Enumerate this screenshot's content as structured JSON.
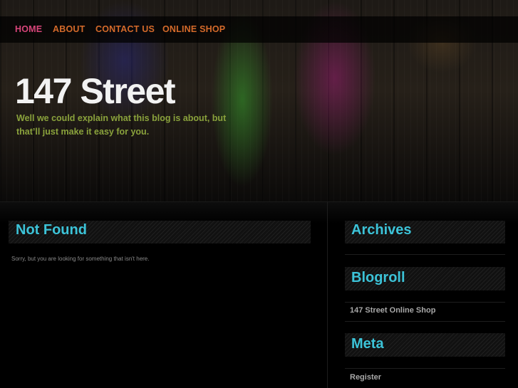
{
  "nav": {
    "home": "HOME",
    "about": "ABOUT",
    "contact": "CONTACT US",
    "shop": "ONLINE SHOP"
  },
  "site": {
    "title": "147 Street",
    "tagline": "Well we could explain what this blog is about, but that’ll just make it easy for you."
  },
  "main": {
    "heading": "Not Found",
    "message": "Sorry, but you are looking for something that isn't here."
  },
  "sidebar": {
    "archives_title": "Archives",
    "blogroll_title": "Blogroll",
    "blogroll_links": [
      "147 Street Online Shop"
    ],
    "meta_title": "Meta",
    "meta_links": [
      "Register"
    ]
  },
  "colors": {
    "nav_active": "#d8457a",
    "nav_link": "#d46a2a",
    "heading": "#3cc3d8",
    "tagline": "#8aa23c"
  }
}
